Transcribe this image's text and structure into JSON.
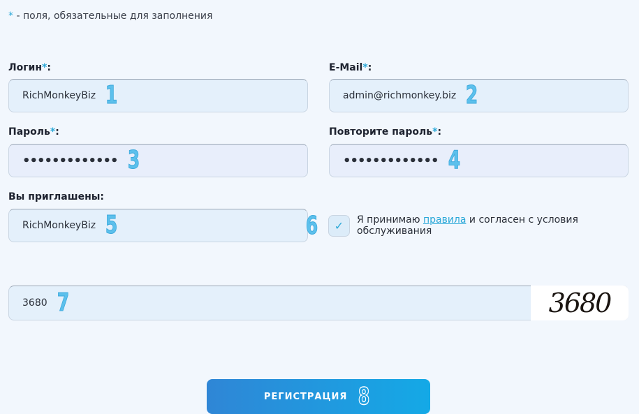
{
  "required_note": {
    "star": "*",
    "text": " - поля, обязательные для заполнения"
  },
  "fields": {
    "login": {
      "label": "Логин",
      "value": "RichMonkeyBiz",
      "marker": "1"
    },
    "email": {
      "label": "E-Mail",
      "value": "admin@richmonkey.biz",
      "marker": "2"
    },
    "password": {
      "label": "Пароль",
      "value": "•••••••••••••",
      "marker": "3"
    },
    "password_repeat": {
      "label": "Повторите пароль",
      "value": "•••••••••••••",
      "marker": "4"
    },
    "invited": {
      "label": "Вы приглашены:",
      "value": "RichMonkeyBiz",
      "marker": "5"
    }
  },
  "required_suffix": "*",
  "colon": ":",
  "agree": {
    "marker": "6",
    "checkmark": "✓",
    "text_before": "Я принимаю ",
    "link": "правила",
    "text_after": " и согласен с условия обслуживания",
    "checked": true
  },
  "captcha": {
    "value": "3680",
    "marker": "7",
    "image_text": "3680"
  },
  "register_button": {
    "label": "РЕГИСТРАЦИЯ",
    "marker": "8"
  },
  "colors": {
    "accent": "#2aa8d8",
    "marker": "#5cc0ec",
    "button_start": "#2f86d6",
    "button_end": "#14a9e6"
  }
}
